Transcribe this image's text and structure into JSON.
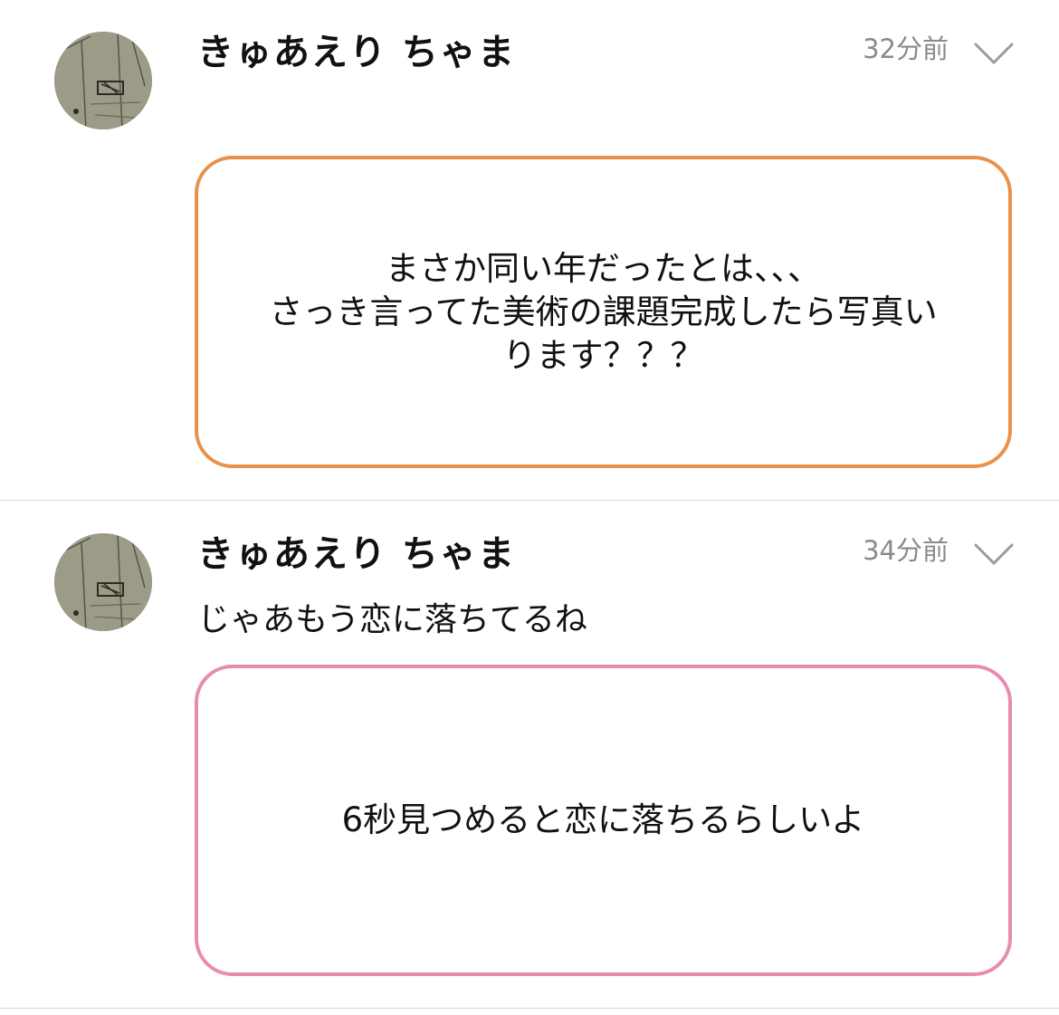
{
  "colors": {
    "orange_border": "#e9924a",
    "pink_border": "#e88bb3",
    "timestamp": "#8a8a8a",
    "divider": "#d9d9d9"
  },
  "posts": [
    {
      "username": "きゅあえり ちゃま",
      "time": "32分前",
      "avatar_icon": "sketch-avatar",
      "menu_icon": "chevron-down-icon",
      "body": "",
      "card": {
        "border_color": "orange",
        "lines": [
          "まさか同い年だったとは、、、",
          "さっき言ってた美術の課題完成したら写真い",
          "ります？？？"
        ]
      }
    },
    {
      "username": "きゅあえり ちゃま",
      "time": "34分前",
      "avatar_icon": "sketch-avatar",
      "menu_icon": "chevron-down-icon",
      "body": "じゃあもう恋に落ちてるね",
      "card": {
        "border_color": "pink",
        "lines": [
          "6秒見つめると恋に落ちるらしいよ"
        ]
      }
    }
  ]
}
